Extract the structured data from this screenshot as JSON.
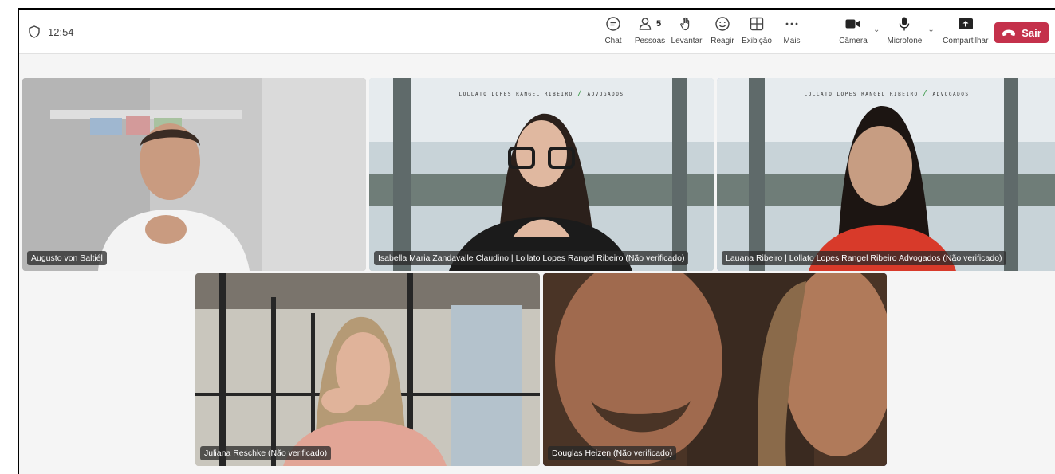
{
  "meeting": {
    "elapsed": "12:54",
    "people_count": "5"
  },
  "toolbar": {
    "chat": "Chat",
    "people": "Pessoas",
    "raise": "Levantar",
    "react": "Reagir",
    "view": "Exibição",
    "more": "Mais",
    "camera": "Câmera",
    "mic": "Microfone",
    "share": "Compartilhar",
    "leave": "Sair"
  },
  "participants": [
    {
      "name": "Augusto von Saltiél"
    },
    {
      "name": "Isabella Maria Zandavalle Claudino | Lollato Lopes Rangel Ribeiro (Não verificado)",
      "banner": "LOLLATO LOPES RANGEL RIBEIRO",
      "banner_suffix": "ADVOGADOS"
    },
    {
      "name": "Lauana Ribeiro | Lollato Lopes Rangel Ribeiro Advogados (Não verificado)",
      "banner": "LOLLATO LOPES RANGEL RIBEIRO",
      "banner_suffix": "ADVOGADOS"
    },
    {
      "name": "Juliana Reschke (Não verificado)"
    },
    {
      "name": "Douglas Heizen (Não verificado)"
    }
  ],
  "colors": {
    "leave": "#c4314b",
    "active_speaker": "#7f85f5"
  },
  "icons": [
    "shield-icon",
    "chat-icon",
    "people-icon",
    "hand-icon",
    "smile-icon",
    "grid-icon",
    "more-icon",
    "camera-icon",
    "mic-icon",
    "share-icon",
    "phone-icon"
  ]
}
